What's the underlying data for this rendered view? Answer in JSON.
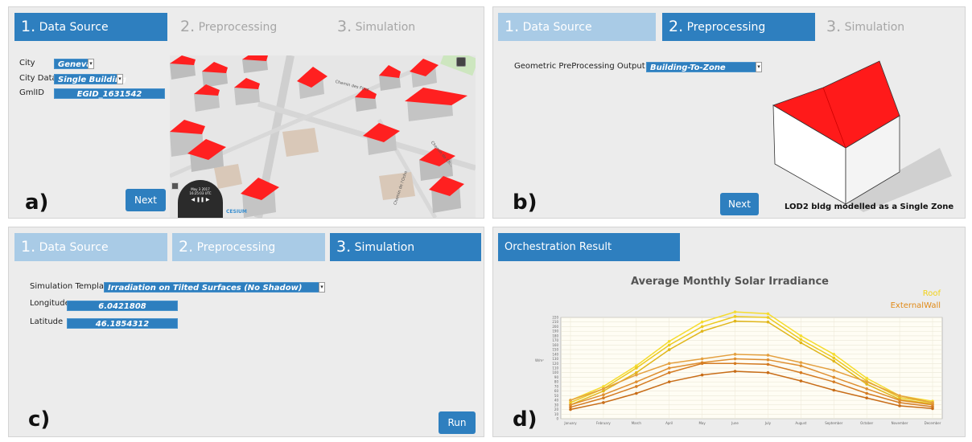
{
  "panel_a": {
    "tabs": [
      {
        "num": "1.",
        "label": "Data Source"
      },
      {
        "num": "2.",
        "label": "Preprocessing"
      },
      {
        "num": "3.",
        "label": "Simulation"
      }
    ],
    "city_label": "City",
    "city_value": "Geneva",
    "city_data_label": "City Data",
    "city_data_value": "Single Building",
    "gmlid_label": "GmlID",
    "gmlid_value": "EGID_1631542",
    "next_label": "Next",
    "letter": "a)",
    "map": {
      "clock_date": "May 3 2017",
      "clock_time": "16:25:03 UTC",
      "cesium_label": "CESIUM",
      "street_labels": [
        "Chemin des Fouz",
        "Chemin de l'Oche",
        "Chemin de Ch..."
      ]
    }
  },
  "panel_b": {
    "tabs": [
      {
        "num": "1.",
        "label": "Data Source"
      },
      {
        "num": "2.",
        "label": "Preprocessing"
      },
      {
        "num": "3.",
        "label": "Simulation"
      }
    ],
    "output_label": "Geometric PreProcessing Output",
    "output_value": "Building-To-Zone",
    "next_label": "Next",
    "caption": "LOD2 bldg modelled as a Single Zone",
    "letter": "b)"
  },
  "panel_c": {
    "tabs": [
      {
        "num": "1.",
        "label": "Data Source"
      },
      {
        "num": "2.",
        "label": "Preprocessing"
      },
      {
        "num": "3.",
        "label": "Simulation"
      }
    ],
    "template_label": "Simulation Template",
    "template_value": "Irradiation on Tilted Surfaces (No Shadow)",
    "longitude_label": "Longitude",
    "longitude_value": "6.0421808",
    "latitude_label": "Latitude",
    "latitude_value": "46.1854312",
    "run_label": "Run",
    "letter": "c)"
  },
  "panel_d": {
    "header": "Orchestration Result",
    "letter": "d)"
  },
  "colors": {
    "accent": "#2e7fbf",
    "tab_done": "#a9cbe6",
    "roof": "#f2d21a",
    "external_wall": "#e08a18",
    "building_roof": "#ff1a1a"
  },
  "chart_data": {
    "type": "line",
    "title": "Average Monthly Solar Irradiance",
    "xlabel": "",
    "ylabel": "W/m²",
    "ylim": [
      0,
      220
    ],
    "yticks": [
      0,
      10,
      20,
      30,
      40,
      50,
      60,
      70,
      80,
      90,
      100,
      110,
      120,
      130,
      140,
      150,
      160,
      170,
      180,
      190,
      200,
      210,
      220
    ],
    "grid": true,
    "legend": {
      "position": "top-right",
      "entries": [
        "Roof",
        "ExternalWall"
      ]
    },
    "categories": [
      "January",
      "February",
      "March",
      "April",
      "May",
      "June",
      "July",
      "August",
      "September",
      "October",
      "November",
      "December"
    ],
    "series": [
      {
        "name": "Roof",
        "color": "#f5dc30",
        "values": [
          40,
          70,
          115,
          168,
          210,
          232,
          228,
          180,
          140,
          88,
          50,
          38
        ]
      },
      {
        "name": "Roof",
        "color": "#ecca20",
        "values": [
          35,
          65,
          110,
          160,
          200,
          222,
          220,
          172,
          132,
          82,
          46,
          35
        ]
      },
      {
        "name": "Roof",
        "color": "#e0b61a",
        "values": [
          30,
          60,
          100,
          150,
          190,
          212,
          210,
          165,
          125,
          75,
          42,
          32
        ]
      },
      {
        "name": "ExternalWall",
        "color": "#e4a040",
        "values": [
          40,
          65,
          95,
          120,
          130,
          140,
          138,
          122,
          105,
          80,
          50,
          35
        ]
      },
      {
        "name": "ExternalWall",
        "color": "#de8e30",
        "values": [
          30,
          52,
          80,
          110,
          122,
          130,
          128,
          115,
          90,
          65,
          40,
          30
        ]
      },
      {
        "name": "ExternalWall",
        "color": "#d47b22",
        "values": [
          25,
          45,
          70,
          100,
          120,
          120,
          118,
          100,
          80,
          55,
          35,
          26
        ]
      },
      {
        "name": "ExternalWall",
        "color": "#c86d18",
        "values": [
          20,
          35,
          55,
          80,
          95,
          103,
          100,
          82,
          62,
          45,
          28,
          22
        ]
      }
    ]
  }
}
